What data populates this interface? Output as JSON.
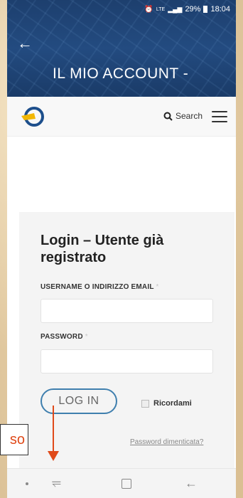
{
  "status_bar": {
    "icons": [
      "alarm-icon",
      "lte-signal-icon",
      "battery-icon"
    ],
    "signal_text": "LTE",
    "battery": "29%",
    "time": "18:04"
  },
  "header": {
    "title": "IL MIO ACCOUNT -",
    "back_icon": "arrow-left-icon"
  },
  "navbar": {
    "logo_icon": "site-logo",
    "search_label": "Search",
    "menu_icon": "hamburger-menu-icon"
  },
  "login": {
    "heading": "Login – Utente già registrato",
    "username_label": "USERNAME O INDIRIZZO EMAIL",
    "username_value": "",
    "password_label": "PASSWORD",
    "password_value": "",
    "required_mark": "*",
    "button_label": "LOG IN",
    "remember_label": "Ricordami",
    "remember_checked": false,
    "forgot_link": "Password dimenticata?"
  },
  "system_nav": {
    "icons": [
      "dot-icon",
      "recent-apps-icon",
      "home-icon",
      "back-icon"
    ]
  },
  "annotation": {
    "text": "so",
    "color": "#e04a1a"
  },
  "colors": {
    "header_bg": "#1d3f6e",
    "button_border": "#3f7fae",
    "card_bg": "#f4f4f4"
  }
}
